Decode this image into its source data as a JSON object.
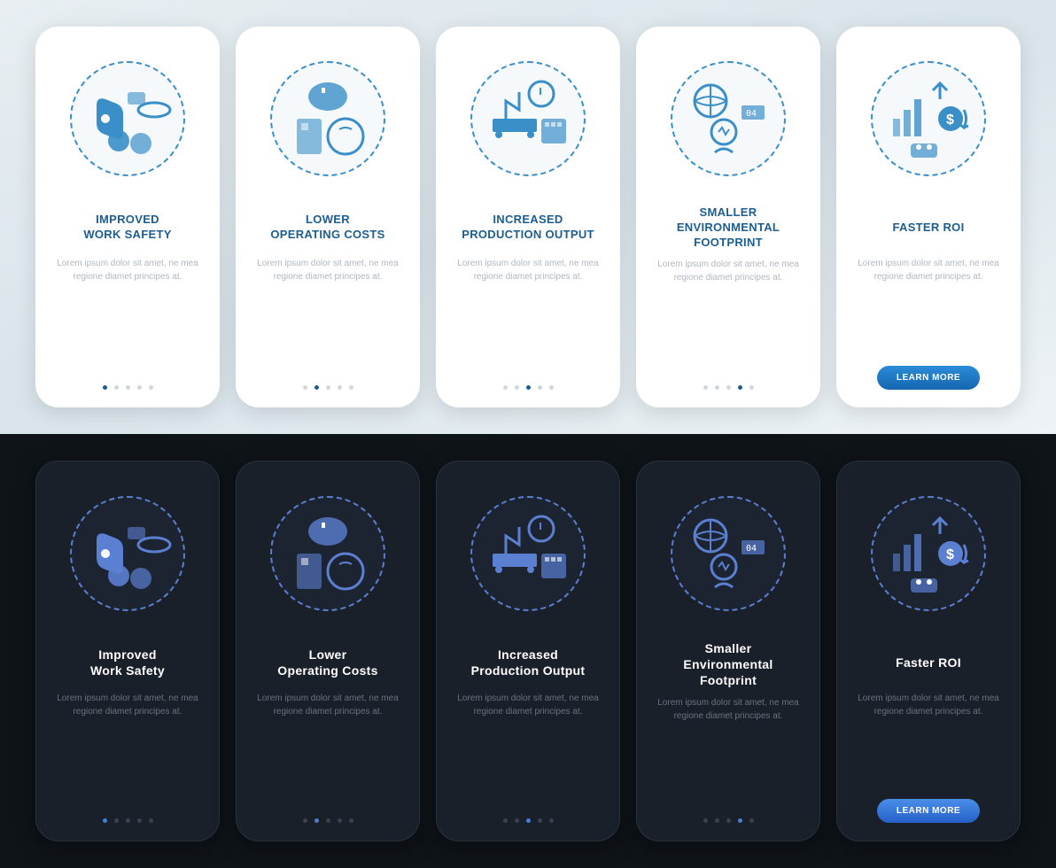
{
  "colors": {
    "light_accent": "#1d5d8f",
    "light_icon": "#3a8fc8",
    "dark_bg": "#1a2029",
    "dark_accent": "#4a7fd8"
  },
  "body": "Lorem ipsum dolor sit amet, ne mea regione diamet principes at.",
  "cta_label": "LEARN MORE",
  "screens": [
    {
      "title_light": "IMPROVED\nWORK SAFETY",
      "title_dark": "Improved\nWork Safety",
      "icon": "safety",
      "active": 0
    },
    {
      "title_light": "LOWER\nOPERATING COSTS",
      "title_dark": "Lower\nOperating Costs",
      "icon": "costs",
      "active": 1
    },
    {
      "title_light": "INCREASED\nPRODUCTION OUTPUT",
      "title_dark": "Increased\nProduction Output",
      "icon": "production",
      "active": 2
    },
    {
      "title_light": "SMALLER\nENVIRONMENTAL\nFOOTPRINT",
      "title_dark": "Smaller\nEnvironmental\nFootprint",
      "icon": "environment",
      "active": 3
    },
    {
      "title_light": "FASTER ROI",
      "title_dark": "Faster ROI",
      "icon": "roi",
      "active": 4
    }
  ]
}
